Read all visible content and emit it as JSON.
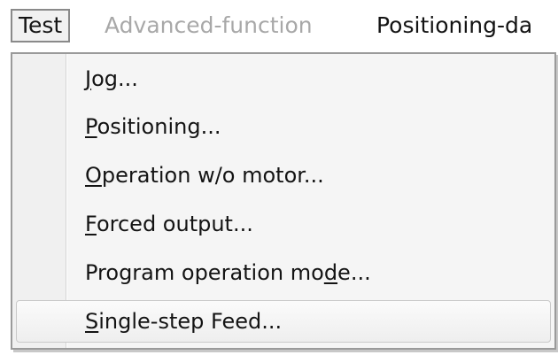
{
  "menubar": {
    "items": [
      {
        "label": "Test",
        "state": "active"
      },
      {
        "label": "Advanced-function",
        "state": "disabled"
      },
      {
        "label": "Positioning-da",
        "state": "enabled"
      }
    ]
  },
  "dropdown": {
    "items": [
      {
        "pre": "",
        "mn": "J",
        "post": "og..."
      },
      {
        "pre": "",
        "mn": "P",
        "post": "ositioning..."
      },
      {
        "pre": "",
        "mn": "O",
        "post": "peration w/o motor..."
      },
      {
        "pre": "",
        "mn": "F",
        "post": "orced output..."
      },
      {
        "pre": "Program operation mo",
        "mn": "d",
        "post": "e..."
      },
      {
        "pre": "",
        "mn": "S",
        "post": "ingle-step Feed...",
        "highlighted": true
      }
    ]
  },
  "colors": {
    "text": "#141414",
    "disabled_text": "#a8a8a8",
    "menu_background": "#f5f5f5"
  }
}
